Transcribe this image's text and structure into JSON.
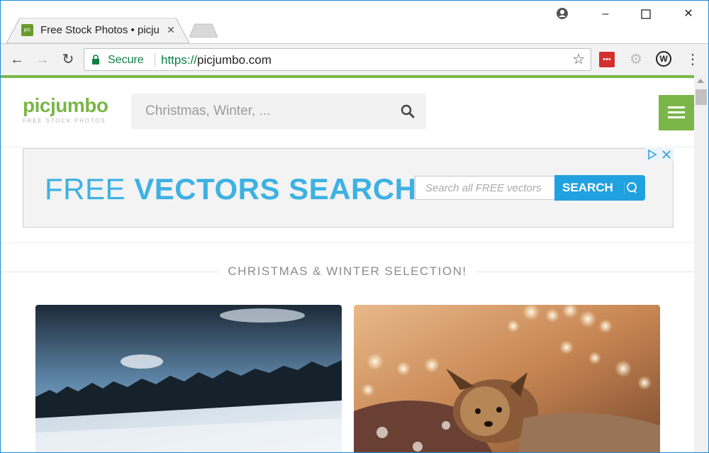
{
  "browser": {
    "tab_title": "Free Stock Photos • picjumbo",
    "tab_favicon_text": "pic",
    "secure_label": "Secure",
    "url_scheme": "https://",
    "url_host": "picjumbo.com"
  },
  "header": {
    "logo_text": "picjumbo",
    "logo_tagline": "FREE STOCK PHOTOS",
    "search_placeholder": "Christmas, Winter, ..."
  },
  "ad": {
    "headline_light": "FREE ",
    "headline_bold": "VECTORS SEARCH",
    "input_placeholder": "Search all FREE vectors",
    "button_label": "SEARCH"
  },
  "section": {
    "title": "CHRISTMAS & WINTER SELECTION!"
  },
  "photos": [
    {
      "subject": "snowy ski slope with pine forest"
    },
    {
      "subject": "yorkshire terrier with bokeh lights"
    }
  ],
  "colors": {
    "brand_green": "#7ab648",
    "ad_blue": "#3db1e3",
    "secure_green": "#0b8043"
  }
}
